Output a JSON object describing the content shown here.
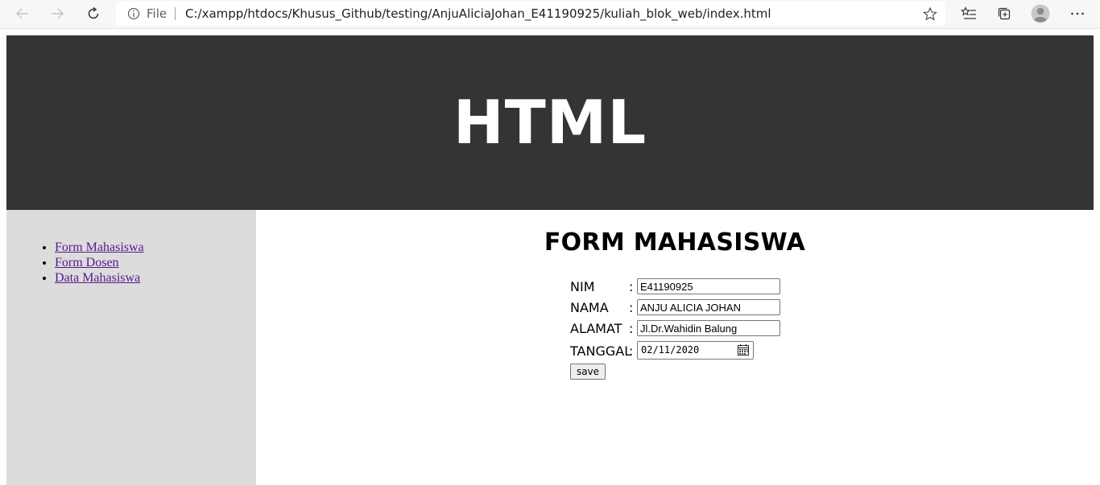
{
  "browser": {
    "scheme_label": "File",
    "url": "C:/xampp/htdocs/Khusus_Github/testing/AnjuAliciaJohan_E41190925/kuliah_blok_web/index.html",
    "icons": [
      "back-arrow-icon",
      "forward-arrow-icon",
      "refresh-icon",
      "info-icon",
      "star-icon",
      "favorites-list-icon",
      "collections-icon",
      "profile-avatar-icon",
      "more-dots-icon"
    ]
  },
  "header": {
    "title": "HTML"
  },
  "sidebar": {
    "items": [
      {
        "label": "Form Mahasiswa"
      },
      {
        "label": "Form Dosen"
      },
      {
        "label": "Data Mahasiswa"
      }
    ]
  },
  "form": {
    "title": "FORM MAHASISWA",
    "colon": ":",
    "fields": [
      {
        "label": "NIM",
        "value": "E41190925"
      },
      {
        "label": "NAMA",
        "value": "ANJU ALICIA JOHAN"
      },
      {
        "label": "ALAMAT",
        "value": "Jl.Dr.Wahidin Balung"
      },
      {
        "label": "TANGGAL",
        "value": "02/11/2020"
      }
    ],
    "save_label": "save"
  },
  "colors": {
    "header_bg": "#343434",
    "sidebar_bg": "#dcdcdc",
    "link_visited": "#551a8b"
  }
}
